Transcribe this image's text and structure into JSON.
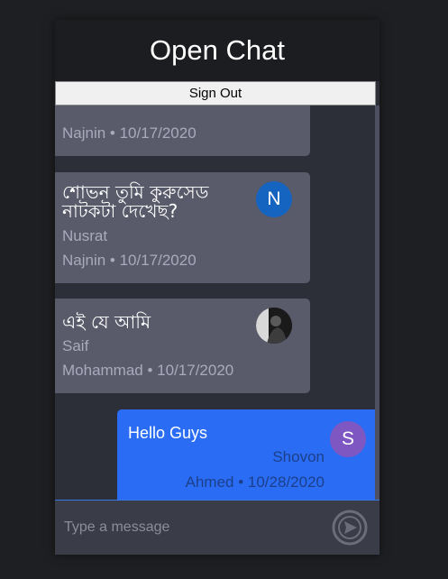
{
  "header": {
    "title": "Open Chat"
  },
  "auth": {
    "sign_out_label": "Sign Out"
  },
  "messages": [
    {
      "meta_line1": "Najnin • 10/17/2020"
    },
    {
      "text_line1": "শোভন তুমি কুরুসেড",
      "text_line2": "নাটকটা দেখেছ?",
      "meta_line1": "Nusrat",
      "meta_line2": "Najnin • 10/17/2020",
      "avatar_letter": "N",
      "avatar_color": "#1565c0"
    },
    {
      "text_line1": "এই যে আমি",
      "meta_line1": "Saif",
      "meta_line2": "Mohammad • 10/17/2020",
      "avatar": "photo-avatar"
    },
    {
      "text_line1": "Hello Guys",
      "meta_line1": "Shovon",
      "meta_line2": "Ahmed • 10/28/2020",
      "avatar_letter": "S",
      "avatar_color": "#7e57c2"
    }
  ],
  "composer": {
    "placeholder": "Type a message",
    "send_icon": "send-icon"
  },
  "colors": {
    "own_bubble": "#2a6df4",
    "other_bubble": "#595a6a",
    "accent": "#3a78e8"
  }
}
